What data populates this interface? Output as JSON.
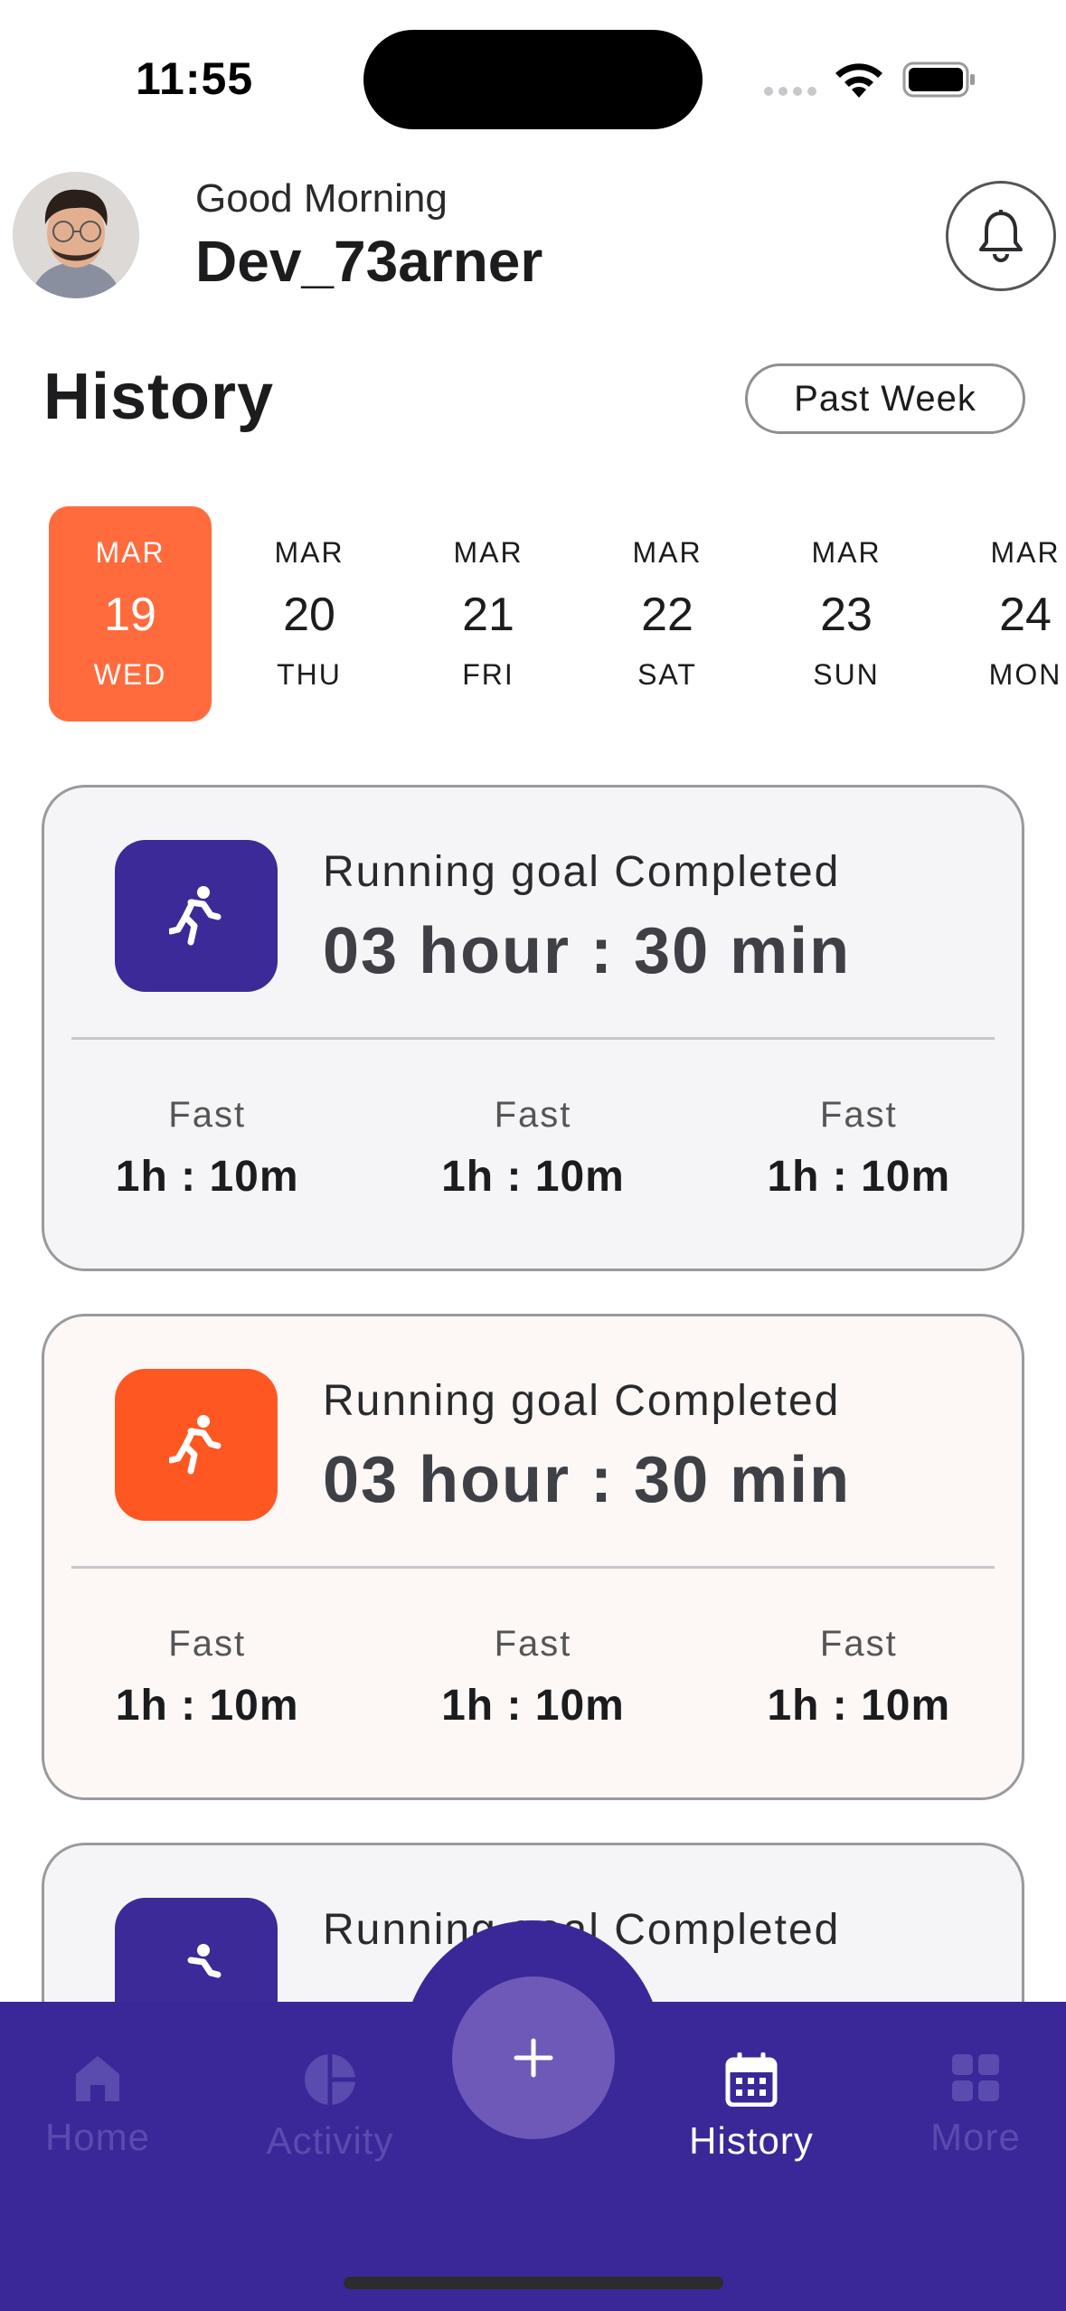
{
  "status_bar": {
    "time": "11:55"
  },
  "header": {
    "greeting": "Good Morning",
    "username": "Dev_73arner"
  },
  "history": {
    "title": "History",
    "range_label": "Past Week"
  },
  "dates": [
    {
      "month": "MAR",
      "day": "19",
      "weekday": "WED",
      "selected": true
    },
    {
      "month": "MAR",
      "day": "20",
      "weekday": "THU",
      "selected": false
    },
    {
      "month": "MAR",
      "day": "21",
      "weekday": "FRI",
      "selected": false
    },
    {
      "month": "MAR",
      "day": "22",
      "weekday": "SAT",
      "selected": false
    },
    {
      "month": "MAR",
      "day": "23",
      "weekday": "SUN",
      "selected": false
    },
    {
      "month": "MAR",
      "day": "24",
      "weekday": "MON",
      "selected": false
    }
  ],
  "cards": [
    {
      "label": "Running goal Completed",
      "value": "03 hour : 30 min",
      "accent": "#3c2a98",
      "stats": [
        {
          "label": "Fast",
          "value": "1h : 10m"
        },
        {
          "label": "Fast",
          "value": "1h : 10m"
        },
        {
          "label": "Fast",
          "value": "1h : 10m"
        }
      ]
    },
    {
      "label": "Running goal Completed",
      "value": "03 hour : 30 min",
      "accent": "#ff5722",
      "stats": [
        {
          "label": "Fast",
          "value": "1h : 10m"
        },
        {
          "label": "Fast",
          "value": "1h : 10m"
        },
        {
          "label": "Fast",
          "value": "1h : 10m"
        }
      ]
    },
    {
      "label": "Running goal Completed",
      "accent": "#3c2a98"
    }
  ],
  "nav": {
    "items": [
      {
        "label": "Home",
        "icon": "home-icon",
        "active": false
      },
      {
        "label": "Activity",
        "icon": "pie-chart-icon",
        "active": false
      },
      {
        "label": "History",
        "icon": "calendar-icon",
        "active": true
      },
      {
        "label": "More",
        "icon": "grid-icon",
        "active": false
      }
    ],
    "fab_icon": "plus-icon"
  },
  "colors": {
    "primary": "#3a2898",
    "accent": "#ff6b3d",
    "fab": "#6e59b8"
  }
}
